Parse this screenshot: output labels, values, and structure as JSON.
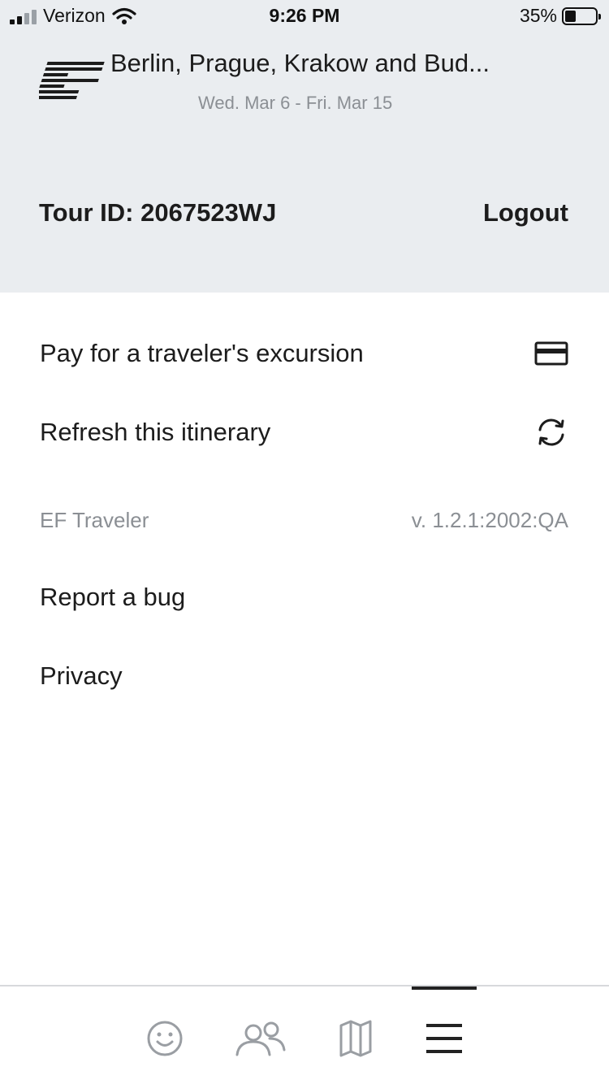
{
  "status_bar": {
    "carrier": "Verizon",
    "time": "9:26 PM",
    "battery_percent": "35%",
    "battery_level": 0.35,
    "signal_bars": 2,
    "icons": [
      "signal-icon",
      "wifi-icon",
      "battery-icon"
    ]
  },
  "header": {
    "tour_title": "Berlin, Prague, Krakow and Bud...",
    "tour_dates": "Wed. Mar 6 - Fri. Mar 15",
    "tour_id": "Tour ID: 2067523WJ",
    "logout_label": "Logout",
    "logo_icon": "ef-logo",
    "background_color": "#eaedf0"
  },
  "menu": {
    "items": [
      {
        "label": "Pay for a traveler's excursion",
        "icon": "credit-card-icon"
      },
      {
        "label": "Refresh this itinerary",
        "icon": "refresh-icon"
      }
    ],
    "app_name": "EF Traveler",
    "app_version": "v. 1.2.1:2002:QA",
    "links": [
      {
        "label": "Report a bug"
      },
      {
        "label": "Privacy"
      }
    ]
  },
  "tab_bar": {
    "tabs": [
      {
        "icon": "smiley-icon",
        "active": false
      },
      {
        "icon": "people-icon",
        "active": false
      },
      {
        "icon": "map-icon",
        "active": false
      },
      {
        "icon": "menu-icon",
        "active": true
      }
    ]
  }
}
